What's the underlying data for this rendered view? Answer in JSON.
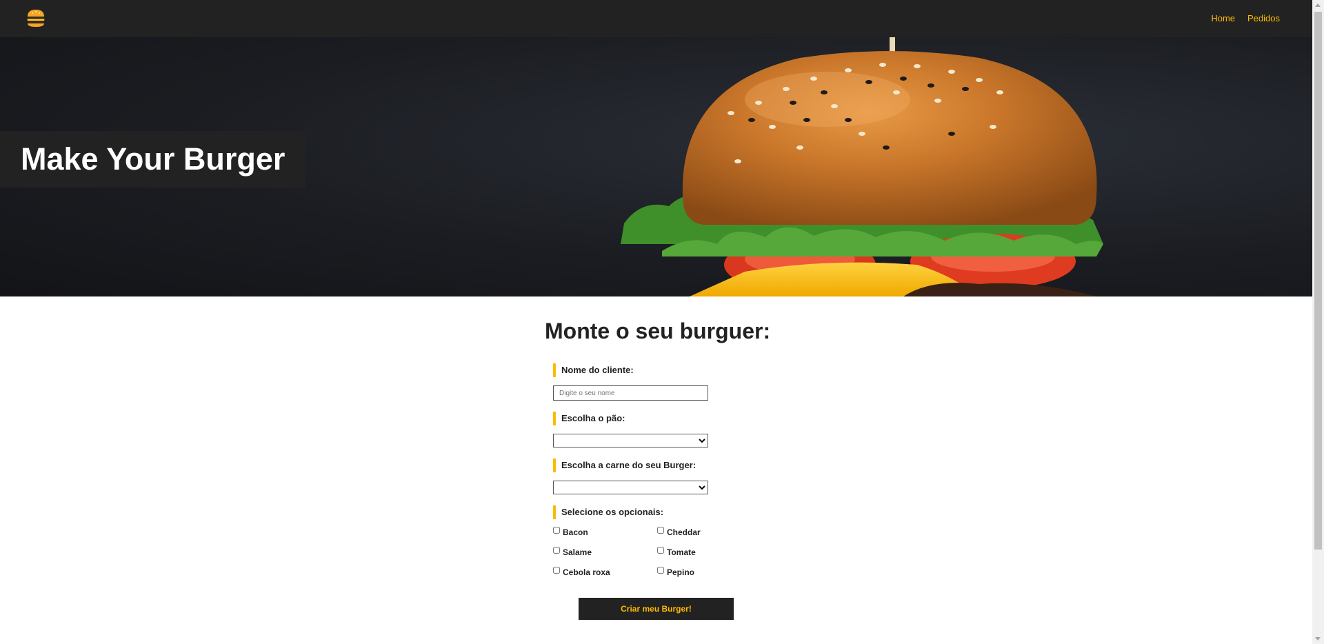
{
  "nav": {
    "links": [
      "Home",
      "Pedidos"
    ],
    "accent_color": "#fcba03",
    "logo_icon": "burger-icon"
  },
  "hero": {
    "title": "Make Your Burger",
    "image": "burger-photo"
  },
  "form": {
    "title": "Monte o seu burguer:",
    "name_label": "Nome do cliente:",
    "name_placeholder": "Digite o seu nome",
    "name_value": "",
    "bread_label": "Escolha o pão:",
    "bread_selected": "",
    "meat_label": "Escolha a carne do seu Burger:",
    "meat_selected": "",
    "optionals_label": "Selecione os opcionais:",
    "optionals": [
      "Bacon",
      "Cheddar",
      "Salame",
      "Tomate",
      "Cebola roxa",
      "Pepino"
    ],
    "submit_label": "Criar meu Burger!"
  }
}
